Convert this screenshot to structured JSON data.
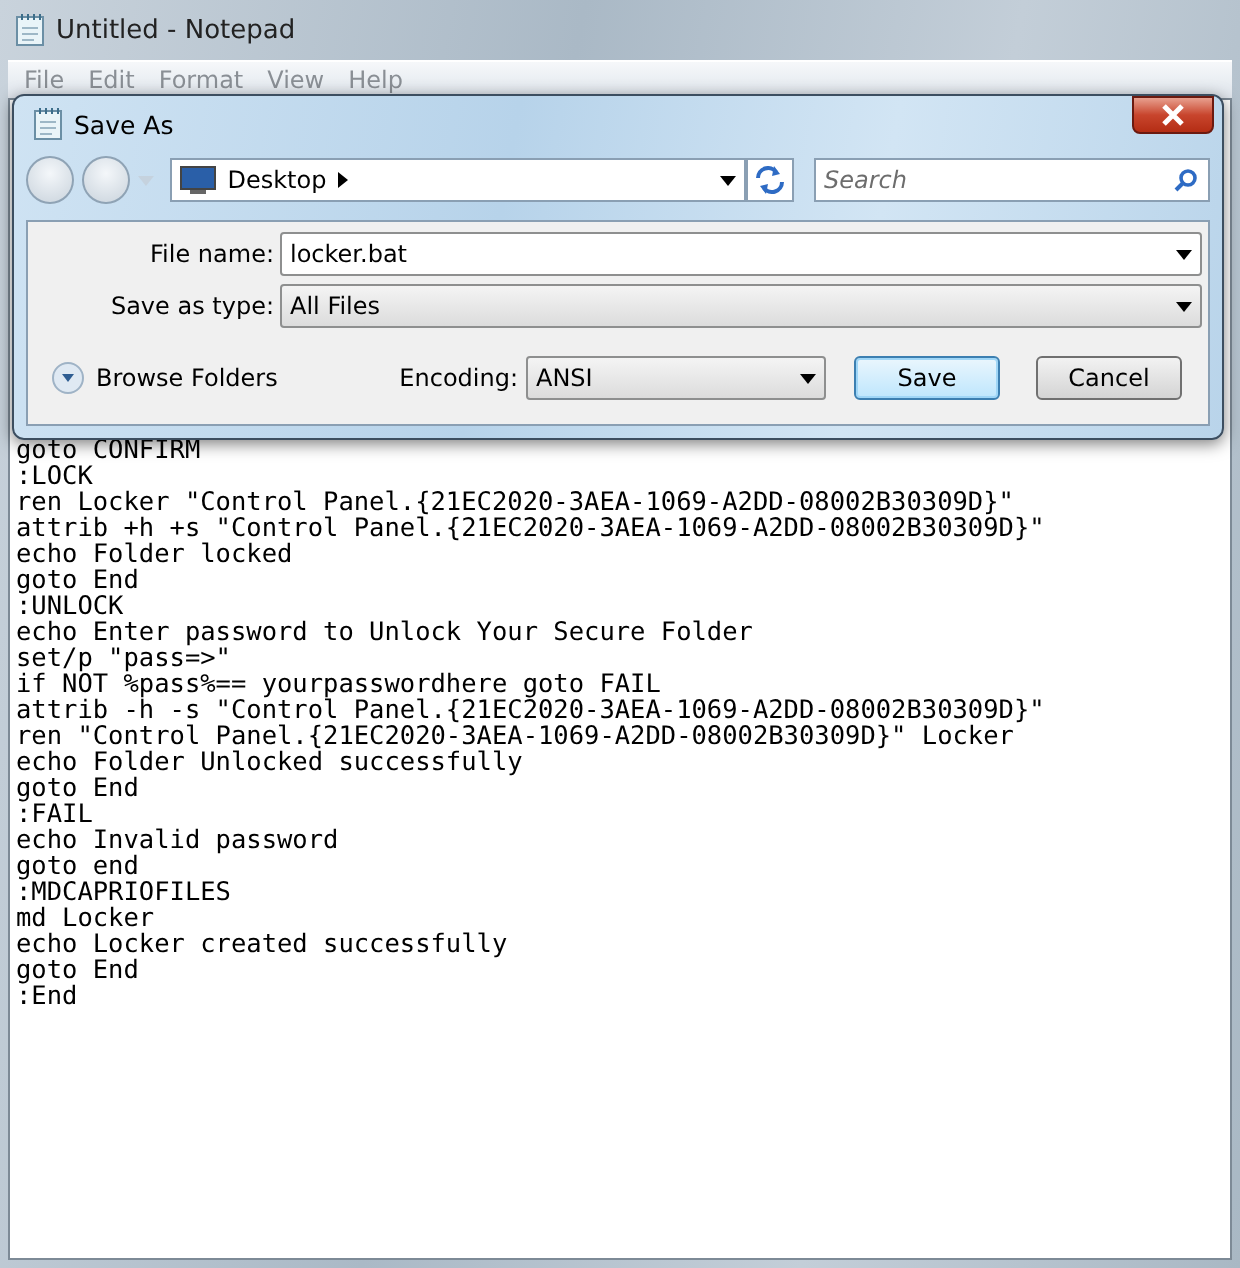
{
  "window": {
    "title": "Untitled - Notepad"
  },
  "menu": [
    "File",
    "Edit",
    "Format",
    "View",
    "Help"
  ],
  "dialog": {
    "title": "Save As",
    "location": "Desktop",
    "search": {
      "placeholder": "Search"
    },
    "file_name": {
      "label": "File name:",
      "value": "locker.bat"
    },
    "save_as_type": {
      "label": "Save as type:",
      "value": "All Files"
    },
    "browse_folders": "Browse Folders",
    "encoding": {
      "label": "Encoding:",
      "value": "ANSI"
    },
    "buttons": [
      {
        "label": "Save",
        "default": true
      },
      {
        "label": "Cancel",
        "default": false
      }
    ]
  },
  "editor": {
    "lines": [
      "goto CONFIRM",
      ":LOCK",
      "ren Locker \"Control Panel.{21EC2020-3AEA-1069-A2DD-08002B30309D}\"",
      "attrib +h +s \"Control Panel.{21EC2020-3AEA-1069-A2DD-08002B30309D}\"",
      "echo Folder locked",
      "goto End",
      ":UNLOCK",
      "echo Enter password to Unlock Your Secure Folder",
      "set/p \"pass=>\"",
      "if NOT %pass%== yourpasswordhere goto FAIL",
      "attrib -h -s \"Control Panel.{21EC2020-3AEA-1069-A2DD-08002B30309D}\"",
      "ren \"Control Panel.{21EC2020-3AEA-1069-A2DD-08002B30309D}\" Locker",
      "echo Folder Unlocked successfully",
      "goto End",
      ":FAIL",
      "echo Invalid password",
      "goto end",
      ":MDCAPRIOFILES",
      "md Locker",
      "echo Locker created successfully",
      "goto End",
      ":End"
    ]
  }
}
